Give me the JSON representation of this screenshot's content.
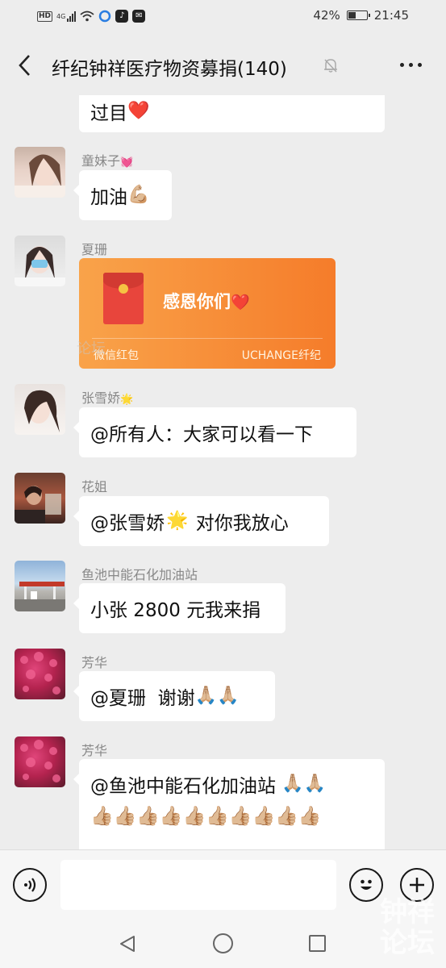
{
  "status_bar": {
    "hd": "HD",
    "network": "4G",
    "battery_percent_label": "42%",
    "battery_level": 0.42,
    "time": "21:45",
    "app_icons": [
      "tiktok-icon",
      "mail-icon"
    ]
  },
  "header": {
    "title": "纤纪钟祥医疗物资募捐(140)"
  },
  "messages": [
    {
      "sender": "",
      "text": "过目",
      "emoji": "❤️"
    },
    {
      "sender": "童妹子",
      "sender_emoji": "💓",
      "text": "加油",
      "emoji": "💪🏼"
    },
    {
      "sender": "夏珊",
      "red_packet": {
        "text": "感恩你们",
        "emoji": "❤️",
        "label": "微信红包",
        "brand": "UCHANGE纤纪"
      }
    },
    {
      "sender": "张雪娇",
      "sender_emoji": "🌟",
      "text": "@所有人：大家可以看一下"
    },
    {
      "sender": "花姐",
      "text_before": "@张雪娇",
      "text_emoji": "🌟",
      "text_after": " 对你我放心"
    },
    {
      "sender": "鱼池中能石化加油站",
      "text": "小张 2800 元我来捐"
    },
    {
      "sender": "芳华",
      "text": "@夏珊  谢谢",
      "emoji": "🙏🏼🙏🏼"
    },
    {
      "sender": "芳华",
      "text": "@鱼池中能石化加油站 ",
      "emoji": "🙏🏼🙏🏼",
      "line2": "👍🏼👍🏼👍🏼👍🏼👍🏼👍🏼👍🏼👍🏼👍🏼👍🏼"
    }
  ],
  "watermark": "钟祥论坛",
  "colors": {
    "background": "#ededed",
    "bubble": "#ffffff",
    "red_packet": "#f7923a"
  }
}
